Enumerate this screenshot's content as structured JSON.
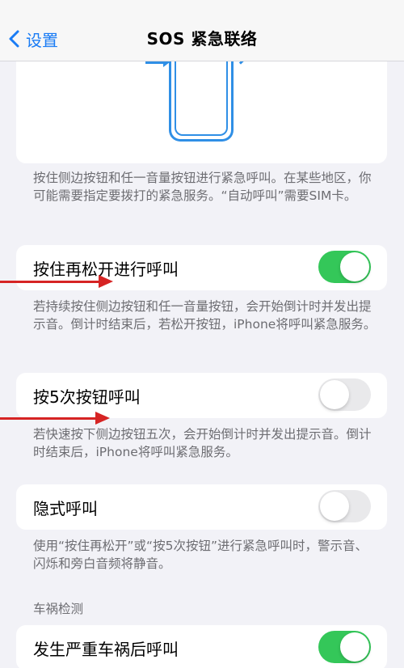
{
  "nav": {
    "back_label": "设置",
    "title": "SOS 紧急联络"
  },
  "illustration": {
    "description_icon": "phone-side-buttons-illustration"
  },
  "footnotes": {
    "hold_buttons": "按住侧边按钮和任一音量按钮进行紧急呼叫。在某些地区，你可能需要指定要拨打的紧急服务。“自动呼叫”需要SIM卡。",
    "hold_release": "若持续按住侧边按钮和任一音量按钮，会开始倒计时并发出提示音。倒计时结束后，若松开按钮，iPhone将呼叫紧急服务。",
    "press_five": "若快速按下侧边按钮五次，会开始倒计时并发出提示音。倒计时结束后，iPhone将呼叫紧急服务。",
    "silent_call": "使用“按住再松开”或“按5次按钮”进行紧急呼叫时，警示音、闪烁和旁白音频将静音。"
  },
  "rows": {
    "hold_release": {
      "label": "按住再松开进行呼叫",
      "toggle_on": true
    },
    "press_five": {
      "label": "按5次按钮呼叫",
      "toggle_on": false
    },
    "silent_call": {
      "label": "隐式呼叫",
      "toggle_on": false
    },
    "crash_call": {
      "label": "发生严重车祸后呼叫",
      "toggle_on": true
    }
  },
  "sections": {
    "crash_detection": "车祸检测"
  },
  "colors": {
    "accent": "#1a7cf5",
    "toggle_on": "#34c759",
    "toggle_off": "#e9e9eb",
    "annotation_arrow": "#d62424"
  }
}
